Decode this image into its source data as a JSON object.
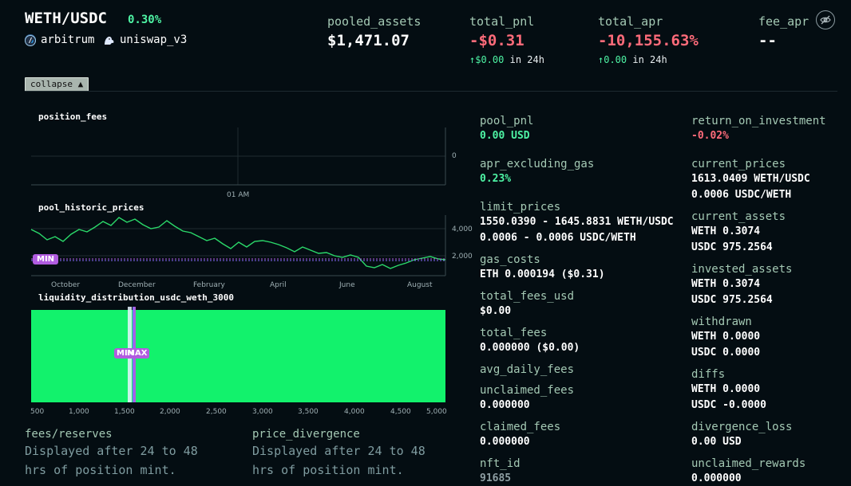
{
  "header": {
    "pair": "WETH/USDC",
    "fee_tier": "0.30%",
    "chain": "arbitrum",
    "dex": "uniswap_v3",
    "metrics": [
      {
        "label": "pooled_assets",
        "value": "$1,471.07"
      },
      {
        "label": "total_pnl",
        "value": "-$0.31",
        "sub_arrow": "↑",
        "sub_value": "$0.00",
        "sub_suffix": "in 24h"
      },
      {
        "label": "total_apr",
        "value": "-10,155.63%",
        "sub_arrow": "↑",
        "sub_value": "0.00",
        "sub_suffix": "in 24h"
      },
      {
        "label": "fee_apr",
        "value": "--"
      }
    ],
    "hide_icon": "eye-slash-icon"
  },
  "collapse": {
    "label": "collapse",
    "arrow": "▲"
  },
  "charts": {
    "position_fees": {
      "title": "position_fees",
      "y_tick": "0",
      "x_tick": "01 AM"
    },
    "pool_historic_prices": {
      "title": "pool_historic_prices",
      "y_ticks": [
        "4,000",
        "2,000"
      ],
      "x_ticks": [
        "October",
        "December",
        "February",
        "April",
        "June",
        "August"
      ],
      "min_label": "MIN"
    },
    "liquidity": {
      "title": "liquidity_distribution_usdc_weth_3000",
      "x_ticks": [
        "500",
        "1,000",
        "1,500",
        "2,000",
        "2,500",
        "3,000",
        "3,500",
        "4,000",
        "4,500",
        "5,000"
      ],
      "min_label": "MIN",
      "max_label": "MAX"
    }
  },
  "footnotes": [
    {
      "label": "fees/reserves",
      "text": "Displayed after 24 to 48 hrs of position mint."
    },
    {
      "label": "price_divergence",
      "text": "Displayed after 24 to 48 hrs of position mint."
    }
  ],
  "stats_left": [
    {
      "label": "pool_pnl",
      "lines": [
        "0.00 USD"
      ],
      "color": "green"
    },
    {
      "label": "apr_excluding_gas",
      "lines": [
        "0.23%"
      ],
      "color": "green"
    },
    {
      "label": "limit_prices",
      "lines": [
        "1550.0390 - 1645.8831 WETH/USDC",
        "0.0006 - 0.0006 USDC/WETH"
      ],
      "color": "white"
    },
    {
      "label": "gas_costs",
      "lines": [
        "ETH 0.000194 ($0.31)"
      ],
      "color": "white"
    },
    {
      "label": "total_fees_usd",
      "lines": [
        "$0.00"
      ],
      "color": "white"
    },
    {
      "label": "total_fees",
      "lines": [
        "0.000000 ($0.00)"
      ],
      "color": "white"
    },
    {
      "label": "avg_daily_fees",
      "lines": [],
      "color": "white"
    },
    {
      "label": "unclaimed_fees",
      "lines": [
        "0.000000"
      ],
      "color": "white"
    },
    {
      "label": "claimed_fees",
      "lines": [
        "0.000000"
      ],
      "color": "white"
    },
    {
      "label": "nft_id",
      "lines": [
        "91685"
      ],
      "color": "muted"
    }
  ],
  "stats_right": [
    {
      "label": "return_on_investment",
      "lines": [
        "-0.02%"
      ],
      "color": "red"
    },
    {
      "label": "current_prices",
      "lines": [
        "1613.0409 WETH/USDC",
        "0.0006 USDC/WETH"
      ],
      "color": "white"
    },
    {
      "label": "current_assets",
      "lines": [
        "WETH 0.3074",
        "USDC 975.2564"
      ],
      "color": "white"
    },
    {
      "label": "invested_assets",
      "lines": [
        "WETH 0.3074",
        "USDC 975.2564"
      ],
      "color": "white"
    },
    {
      "label": "withdrawn",
      "lines": [
        "WETH 0.0000",
        "USDC 0.0000"
      ],
      "color": "white"
    },
    {
      "label": "diffs",
      "lines": [
        "WETH 0.0000",
        "USDC -0.0000"
      ],
      "color": "white"
    },
    {
      "label": "divergence_loss",
      "lines": [
        "0.00 USD"
      ],
      "color": "white"
    },
    {
      "label": "unclaimed_rewards",
      "lines": [
        "0.000000"
      ],
      "color": "white"
    }
  ],
  "colors": {
    "background": "#040d12",
    "accent_green": "#4ef3a4",
    "negative_red": "#ff6b7a",
    "label_green": "#a4c9b4",
    "price_line": "#2bd96a",
    "liquidity_fill": "#12f26c",
    "range_badge": "#b15ce0"
  }
}
